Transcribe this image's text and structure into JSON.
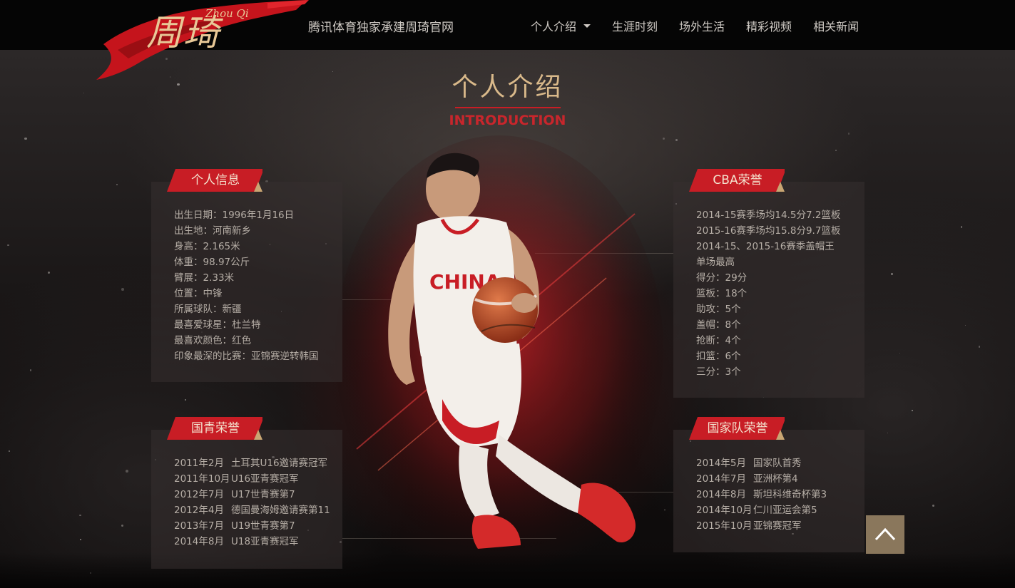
{
  "header": {
    "logo_cn": "周琦",
    "logo_en": "Zhou Qi",
    "tagline": "腾讯体育独家承建周琦官网",
    "nav": [
      {
        "label": "个人介绍",
        "dropdown": true
      },
      {
        "label": "生涯时刻"
      },
      {
        "label": "场外生活"
      },
      {
        "label": "精彩视频"
      },
      {
        "label": "相关新闻"
      }
    ]
  },
  "section": {
    "title_cn": "个人介绍",
    "title_en": "INTRODUCTION"
  },
  "player_jersey_text": "CHINA",
  "panels": {
    "personal": {
      "tag": "个人信息",
      "items": [
        "出生日期：1996年1月16日",
        "出生地：河南新乡",
        "身高：2.165米",
        "体重：98.97公斤",
        "臂展：2.33米",
        "位置：中锋",
        "所属球队：新疆",
        "最喜爱球星：杜兰特",
        "最喜欢颜色：红色",
        "印象最深的比赛：亚锦赛逆转韩国"
      ]
    },
    "cba": {
      "tag": "CBA荣誉",
      "items": [
        "2014-15赛季场均14.5分7.2篮板",
        "2015-16赛季场均15.8分9.7篮板",
        "2014-15、2015-16赛季盖帽王",
        "单场最高",
        "得分：29分",
        "篮板：18个",
        "助攻：5个",
        "盖帽：8个",
        "抢断：4个",
        "扣篮：6个",
        "三分：3个"
      ]
    },
    "youth": {
      "tag": "国青荣誉",
      "items": [
        {
          "date": "2011年2月",
          "text": "土耳其U16邀请赛冠军"
        },
        {
          "date": "2011年10月",
          "text": "U16亚青赛冠军"
        },
        {
          "date": "2012年7月",
          "text": "U17世青赛第7"
        },
        {
          "date": "2012年4月",
          "text": "德国曼海姆邀请赛第11"
        },
        {
          "date": "2013年7月",
          "text": "U19世青赛第7"
        },
        {
          "date": "2014年8月",
          "text": "U18亚青赛冠军"
        }
      ]
    },
    "national": {
      "tag": "国家队荣誉",
      "items": [
        {
          "date": "2014年5月",
          "text": "国家队首秀"
        },
        {
          "date": "2014年7月",
          "text": "亚洲杯第4"
        },
        {
          "date": "2014年8月",
          "text": "斯坦科维奇杯第3"
        },
        {
          "date": "2014年10月",
          "text": "仁川亚运会第5"
        },
        {
          "date": "2015年10月",
          "text": "亚锦赛冠军"
        }
      ]
    }
  },
  "colors": {
    "accent_red": "#c81d25",
    "gold": "#d9b98a",
    "back_to_top": "#8a775c"
  },
  "icons": {
    "back_to_top": "chevron-up-icon",
    "nav_dropdown": "caret-down-icon"
  }
}
